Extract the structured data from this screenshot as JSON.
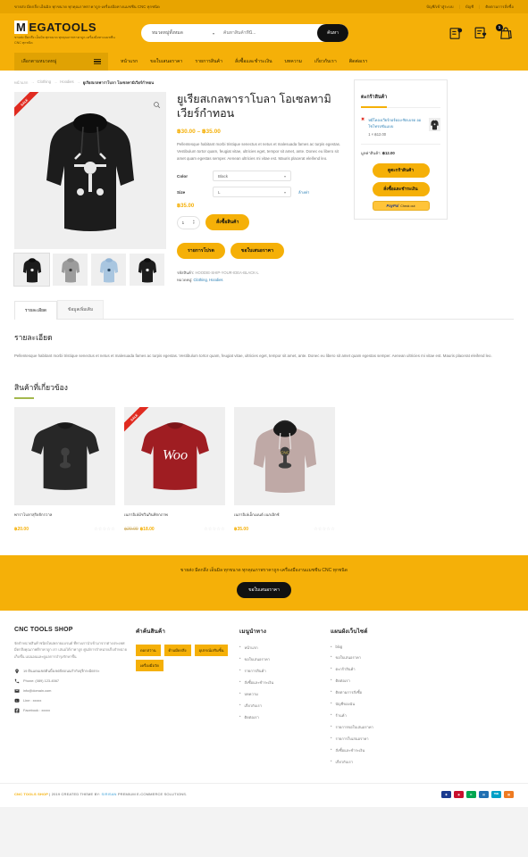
{
  "topbar": {
    "tagline": "ขายส่ง มีดกลึง เอ็นมิล ทุกขนาด ทุกคุณภาพราคาถูก-เครื่องมือทางแมชชีน CNC ทุกชนิด",
    "links": [
      "บัญชี/เข้าสู่ระบบ",
      "บัญชี",
      "ติดตามการสั่งซื้อ"
    ],
    "separator": "|"
  },
  "header": {
    "logo_first": "M",
    "logo_rest": "EGATOOLS",
    "logo_sub": "ขายส่ง มีดกลึง เอ็นมิล ทุกขนาด ทุกคุณภาพราคาถูก-เครื่องมือทางแมชชีน CNC ทุกชนิด",
    "search": {
      "category": "หมวดหมู่ทั้งหมด",
      "placeholder": "ค้นหาสินค้าที่นี่...",
      "value": "",
      "button": "ค้นหา"
    },
    "icons": [
      {
        "name": "compare-icon"
      },
      {
        "name": "wishlist-icon"
      },
      {
        "name": "cart-icon",
        "badge": "1"
      }
    ]
  },
  "nav": {
    "category_label": "เลือกตามหมวดหมู่",
    "links": [
      "หน้าแรก",
      "ขอใบเสนอราคา",
      "รายการสินค้า",
      "สั่งซื้อและชำระเงิน",
      "บทความ",
      "เกี่ยวกับเรา",
      "ติดต่อเรา"
    ]
  },
  "breadcrumb": {
    "items": [
      "หน้าแรก",
      "Clothing",
      "Hoodies"
    ],
    "current": "ยูเรียสเกลพาราโบลา โอเซลทามิเวียร์กำทอน",
    "arrow": "→"
  },
  "product": {
    "sale_badge": "SALE",
    "title": "ยูเรียสเกลพาราโบลา โอเซลทามิเวียร์กำทอน",
    "price_range": "฿30.00 – ฿35.00",
    "description": "Pellentesque habitant morbi tristique senectus et netus et malesuada fames ac turpis egestas. Vestibulum tortor quam, feugiat vitae, ultricies eget, tempor sit amet, ante. Donec eu libero sit amet quam egestas semper. Aenean ultricies mi vitae est. Mauris placerat eleifend leo.",
    "variations": [
      {
        "label": "Color",
        "value": "Black"
      },
      {
        "label": "Size",
        "value": "L"
      }
    ],
    "clear_link": "ล้างค่า",
    "selected_price": "฿35.00",
    "quantity": "1",
    "add_to_cart": "สั่งซื้อสินค้า",
    "extra_buttons": [
      "รายการโปรด",
      "ขอใบเสนอราคา"
    ],
    "sku_label": "รหัสสินค้า:",
    "sku": "HOODIE-SHIP-YOUR-IDEA-BLACK-L",
    "category_label": "หมวดหมู่:",
    "categories": [
      "Clothing",
      "Hoodies"
    ]
  },
  "cart_widget": {
    "title": "ตะกร้าสินค้า",
    "item_name": "หมีโคลงเวียร์กอร์ดอง-ฟิกเบรด ออโซโทรปชั่นแบบ",
    "item_qty": "1 × ฿12.00",
    "subtotal_label": "มูลค่าสินค้า:",
    "subtotal": "฿12.00",
    "buttons": [
      "ดูตะกร้าสินค้า",
      "สั่งซื้อและชำระเงิน"
    ],
    "paypal": "PayPal",
    "paypal_sub": "Check out"
  },
  "tabs": {
    "items": [
      "รายละเอียด",
      "ข้อมูลเพิ่มเติม"
    ],
    "active": 0,
    "heading": "รายละเอียด",
    "body": "Pellentesque habitant morbi tristique senectus et netus et malesuada fames ac turpis egestas. Vestibulum tortor quam, feugiat vitae, ultricies eget, tempor sit amet, ante. Donec eu libero sit amet quam egestas semper. Aenean ultricies mi vitae est. Mauris placerat eleifend leo."
  },
  "related": {
    "heading": "สินค้าที่เกี่ยวข้อง",
    "products": [
      {
        "name": "พาราโบลาสุริยจักรวาล",
        "price": "฿20.00",
        "old_price": "",
        "badge": "",
        "stars": "☆☆☆☆☆",
        "art": "tshirt-black"
      },
      {
        "name": "เนกาอิเล่มีชวินกินพิกกภาพ",
        "price": "฿18.00",
        "old_price": "฿20.00",
        "badge": "SALE",
        "stars": "☆☆☆☆☆",
        "art": "tshirt-red"
      },
      {
        "name": "เนกาอิเล่เอ็กเมนด์ เนกเอิกซ์",
        "price": "฿35.00",
        "old_price": "",
        "badge": "",
        "stars": "☆☆☆☆☆",
        "art": "hoodie-pink"
      }
    ]
  },
  "cta": {
    "text": "ขายส่ง มีดกลึง เอ็นมิล ทุกขนาด ทุกคุณภาพราคาถูก-เครื่องมืองานแมชชีน CNC ทุกชนิด",
    "button": "ขอใบเสนอราคา"
  },
  "footer": {
    "col1": {
      "heading": "CNC TOOLS SHOP",
      "text": "จัดจำหน่ายสินค้าชนิดใหม่หลายแบรนด์ ที่ทางเรานำเข้ามาจากต่างประเทศ มีดกลึงคุณภาพดีราคาถูก เรา เสนอได้ราคาถูก ศูนย์การจำหน่ายเก็บจำหน่ายเก็บชิ้น แน่นอนและดูแลการบำรุงรักษาชิ้น",
      "contacts": [
        {
          "icon": "location-icon",
          "text": "19 ดินแดนเขตดินบิ้งเขตบิดถนนกำกับจุรีกระมิดกระ"
        },
        {
          "icon": "phone-icon",
          "text": "Phone: (089) 123-4567"
        },
        {
          "icon": "mail-icon",
          "text": "info@domain.com"
        },
        {
          "icon": "line-icon",
          "text": "Line : xxxxx"
        },
        {
          "icon": "facebook-icon",
          "text": "Facebook : xxxxx"
        }
      ]
    },
    "col2": {
      "heading": "คำค้นสินค้า",
      "tags": [
        "ดอกสว่าน",
        "ด้ามมีดกลึง",
        "อุปกรณ์เสริมชิ้น",
        "เครื่องมือวัด"
      ]
    },
    "col3": {
      "heading": "เมนูนำทาง",
      "links": [
        "หน้าแรก",
        "ขอใบเสนอราคา",
        "รายการสินค้า",
        "สั่งซื้อและชำระเงิน",
        "บทความ",
        "เกี่ยวกับเรา",
        "ติดต่อเรา"
      ]
    },
    "col4": {
      "heading": "แผนผังเว็บไซต์",
      "links": [
        "blog",
        "ขอใบเสนอราคา",
        "ตะกร้าสินค้า",
        "ติดต่อเรา",
        "ติดตามการสั่งซื้อ",
        "บัญชีของฉัน",
        "ร้านค้า",
        "รายการขอใบเสนอราคา",
        "รายการใบเสนอราคา",
        "สั่งซื้อและชำระเงิน",
        "เกี่ยวกับเรา"
      ]
    }
  },
  "copyright": {
    "shop": "CNC TOOLS SHOP",
    "middle": "| 2019 CREATED THEME BY:",
    "brand": "SIRISAN",
    "tail": "PREMIUM E-COMMERCE SOLUTIONS.",
    "pay_logos": [
      {
        "name": "bank-1",
        "color": "#1a3a8f",
        "glyph": "฿"
      },
      {
        "name": "bank-2",
        "color": "#c8102e",
        "glyph": "◉"
      },
      {
        "name": "bank-3",
        "color": "#00a650",
        "glyph": "K"
      },
      {
        "name": "bank-4",
        "color": "#1f6fb2",
        "glyph": "▤"
      },
      {
        "name": "bank-5",
        "color": "#00a0c6",
        "glyph": "TMB"
      },
      {
        "name": "bank-6",
        "color": "#ef7b22",
        "glyph": "▦"
      }
    ]
  }
}
